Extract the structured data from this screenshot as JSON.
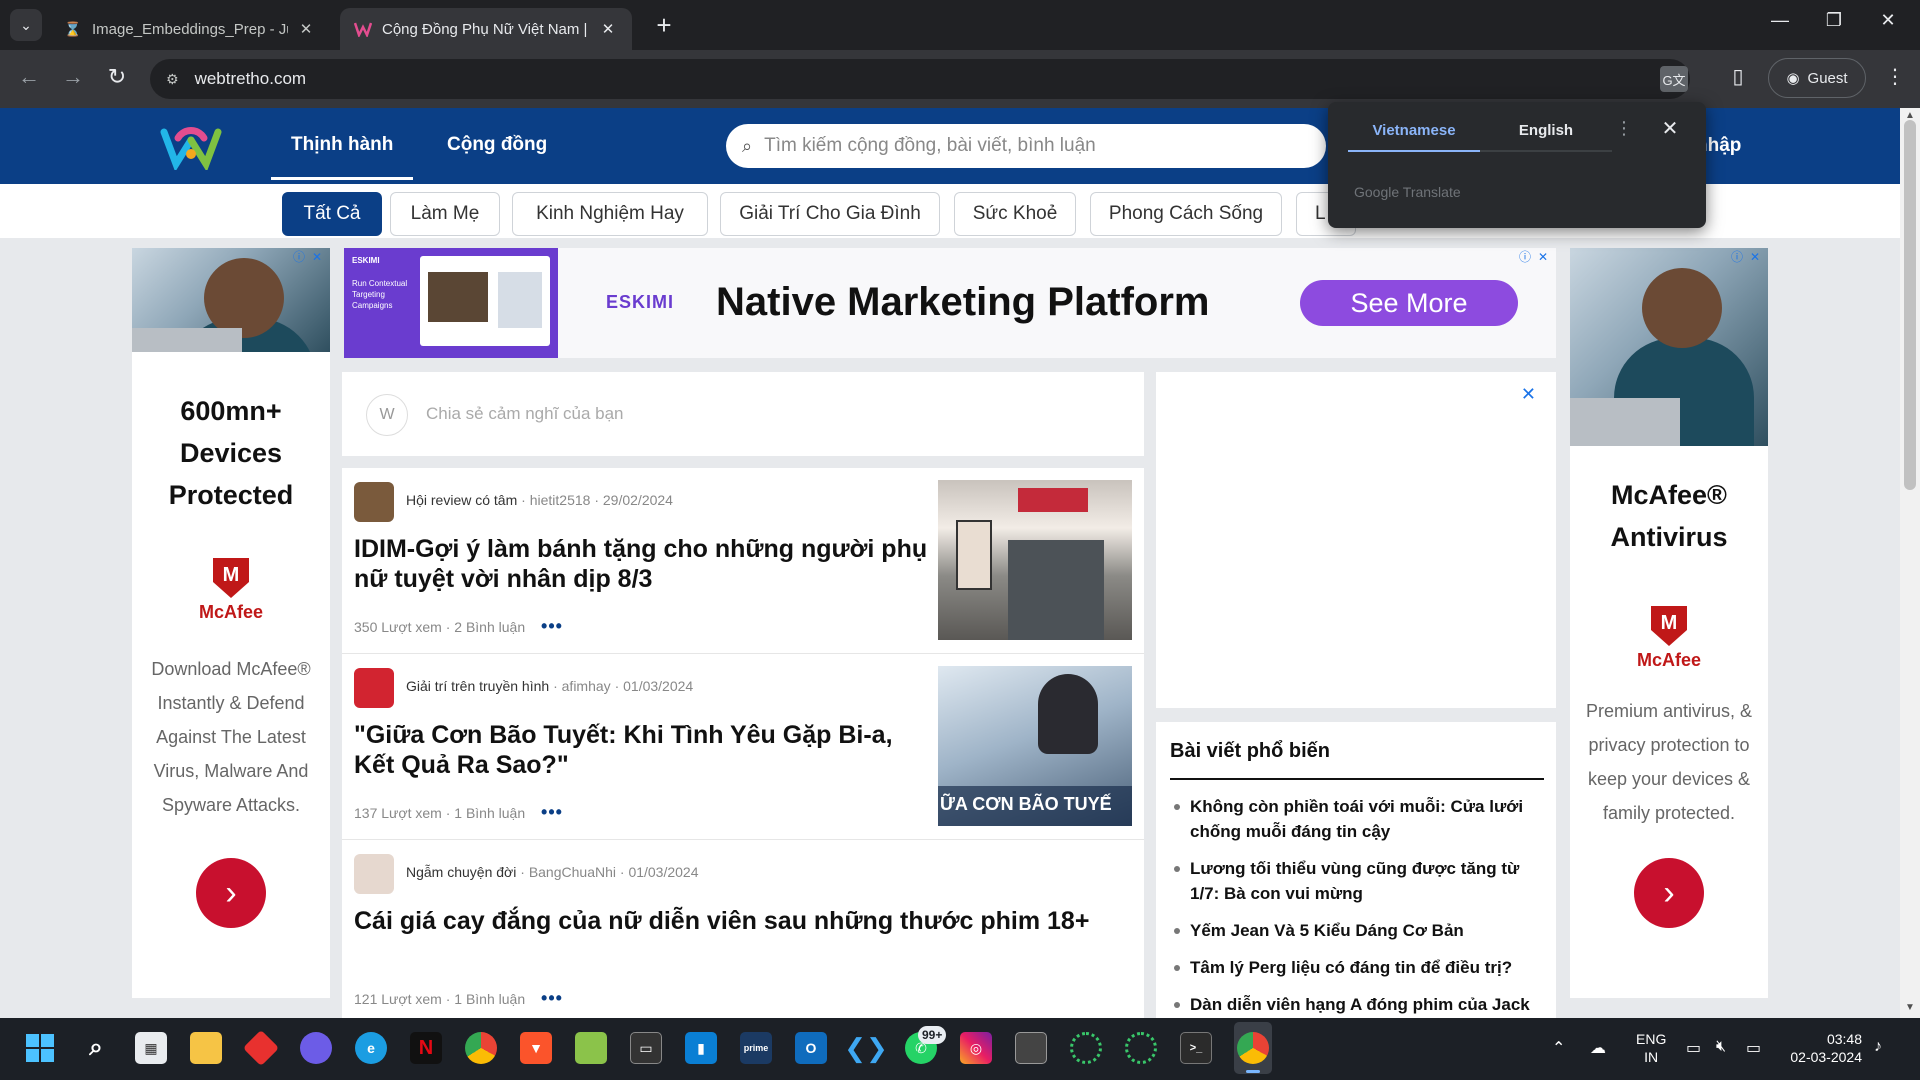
{
  "browser": {
    "tabs": [
      {
        "title": "Image_Embeddings_Prep - Jupy",
        "icon": "hourglass-icon",
        "active": false
      },
      {
        "title": "Cộng Đồng Phụ Nữ Việt Nam |",
        "icon": "webtretho-favicon",
        "active": true
      }
    ],
    "address": "webtretho.com",
    "profile_label": "Guest"
  },
  "site": {
    "nav": [
      "Thịnh hành",
      "Cộng đồng"
    ],
    "search_placeholder": "Tìm kiếm cộng đồng, bài viết, bình luận",
    "login_partial": "nhập",
    "categories": [
      "Tất Cả",
      "Làm Mẹ",
      "Kinh Nghiệm Hay",
      "Giải Trí Cho Gia Đình",
      "Sức Khoẻ",
      "Phong Cách Sống",
      "L"
    ]
  },
  "ads": {
    "left": {
      "headline": [
        "600mn+",
        "Devices",
        "Protected"
      ],
      "brand": "McAfee",
      "body": "Download McAfee® Instantly & Defend Against The Latest Virus, Malware And Spyware Attacks."
    },
    "right": {
      "headline": [
        "McAfee®",
        "Antivirus"
      ],
      "brand": "McAfee",
      "body": "Premium antivirus, & privacy protection to keep your devices & family protected."
    },
    "banner": {
      "logo": "ESKIMI",
      "thumb_label": "ESKIMI",
      "thumb_text": "Run Contextual Targeting Campaigns",
      "title": "Native Marketing Platform",
      "cta": "See More"
    }
  },
  "composer": {
    "placeholder": "Chia sẻ cảm nghĩ của bạn"
  },
  "posts": [
    {
      "community": "Hội review có tâm",
      "author": "hietit2518",
      "date": "29/02/2024",
      "title": "IDIM-Gợi ý làm bánh tặng cho những người phụ nữ tuyệt vời nhân dịp 8/3",
      "views": "350 Lượt xem",
      "comments": "2 Bình luận",
      "thumb_text": ""
    },
    {
      "community": "Giải trí trên truyền hình",
      "author": "afimhay",
      "date": "01/03/2024",
      "title": "\"Giữa Cơn Bão Tuyết: Khi Tình Yêu Gặp Bi-a, Kết Quả Ra Sao?\"",
      "views": "137 Lượt xem",
      "comments": "1 Bình luận",
      "thumb_text": "ỮA CƠN BÃO TUYẾ"
    },
    {
      "community": "Ngẫm chuyện đời",
      "author": "BangChuaNhi",
      "date": "01/03/2024",
      "title": "Cái giá cay đắng của nữ diễn viên sau những thước phim 18+",
      "views": "121 Lượt xem",
      "comments": "1 Bình luận",
      "thumb_text": ""
    }
  ],
  "popular": {
    "heading": "Bài viết phổ biến",
    "items": [
      "Không còn phiền toái với muỗi: Cửa lưới chống muỗi đáng tin cậy",
      "Lương tối thiểu vùng cũng được tăng từ 1/7: Bà con vui mừng",
      "Yếm Jean Và 5 Kiểu Dáng Cơ Bản",
      "Tâm lý Perg liệu có đáng tin để điều trị?",
      "Dàn diễn viên hạng A đóng phim của Jack"
    ]
  },
  "translate": {
    "languages": [
      "Vietnamese",
      "English"
    ],
    "active": "Vietnamese",
    "brand": "Google Translate"
  },
  "taskbar": {
    "whatsapp_badge": "99+",
    "language": [
      "ENG",
      "IN"
    ],
    "time": "03:48",
    "date": "02-03-2024"
  },
  "colors": {
    "site_blue": "#0b3f86",
    "mcafee_red": "#c01818",
    "eskimi_purple": "#8d4bdf",
    "chrome_dark": "#202124"
  }
}
